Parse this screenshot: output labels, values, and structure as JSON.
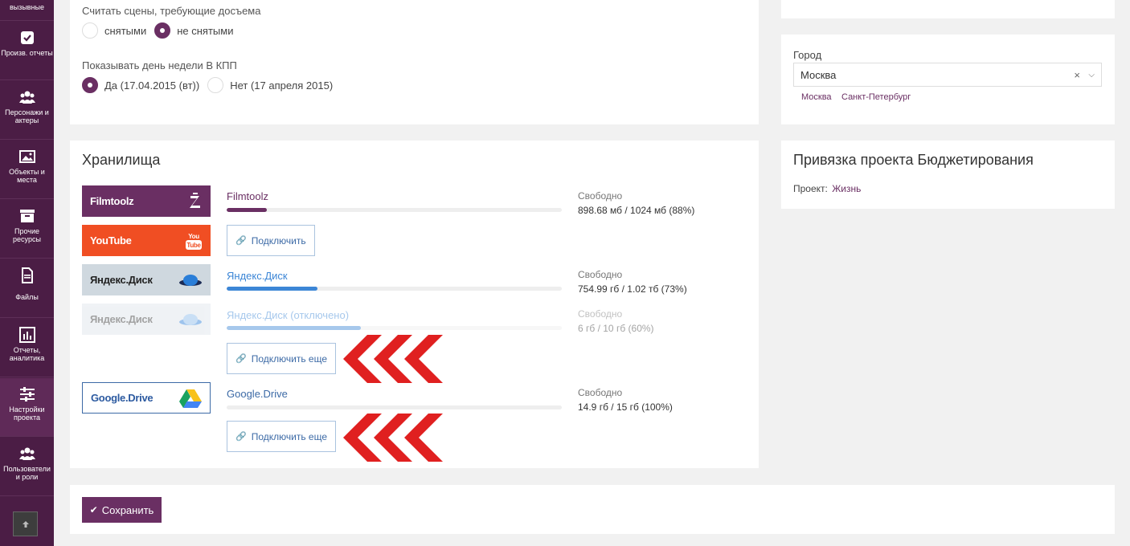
{
  "sidebar": {
    "items": [
      {
        "label": "вызывные",
        "icon": "phone-icon"
      },
      {
        "label": "Произв. отчеты",
        "icon": "checkbox-icon"
      },
      {
        "label": "Персонажи и актеры",
        "icon": "people-icon"
      },
      {
        "label": "Объекты и места",
        "icon": "image-icon"
      },
      {
        "label": "Прочие ресурсы",
        "icon": "archive-icon"
      },
      {
        "label": "Файлы",
        "icon": "file-icon"
      },
      {
        "label": "Отчеты, аналитика",
        "icon": "bar-chart-icon"
      },
      {
        "label": "Настройки проекта",
        "icon": "sliders-icon"
      },
      {
        "label": "Пользователи и роли",
        "icon": "users-icon"
      }
    ]
  },
  "settings": {
    "reshoot_label": "Считать сцены, требующие досъема",
    "reshoot_opt1": "снятыми",
    "reshoot_opt2": "не снятыми",
    "weekday_label": "Показывать день недели В КПП",
    "weekday_opt1": "Да (17.04.2015 (вт))",
    "weekday_opt2": "Нет (17 апреля 2015)"
  },
  "city": {
    "label": "Город",
    "value": "Москва",
    "clear": "×",
    "suggestions": [
      "Москва",
      "Санкт-Петербург"
    ]
  },
  "storage": {
    "title": "Хранилища",
    "free_label": "Свободно",
    "items": [
      {
        "logo": "Filmtoolz",
        "name": "Filmtoolz",
        "free": "898.68 мб / 1024 мб (88%)",
        "used_fraction": 0.12
      },
      {
        "logo": "YouTube",
        "button": "Подключить"
      },
      {
        "logo": "Яндекс.Диск",
        "name": "Яндекс.Диск",
        "free": "754.99 гб / 1.02 тб (73%)",
        "used_fraction": 0.27
      },
      {
        "logo": "Яндекс.Диск",
        "name": "Яндекс.Диск (отключено)",
        "free": "6 гб / 10 гб (60%)",
        "used_fraction": 0.4,
        "button": "Подключить еще"
      },
      {
        "logo": "Google.Drive",
        "name": "Google.Drive",
        "free": "14.9 гб / 15 гб (100%)",
        "used_fraction": 0.0,
        "button": "Подключить еще"
      }
    ]
  },
  "budget": {
    "title": "Привязка проекта Бюджетирования",
    "project_label": "Проект:",
    "project_value": "Жизнь"
  },
  "footer": {
    "save_label": "Сохранить"
  },
  "colors": {
    "brand": "#6a2f63",
    "sidebar": "#4b1d45",
    "youtube": "#f04e23",
    "link": "#3c6aa6",
    "arrow": "#e02020"
  }
}
